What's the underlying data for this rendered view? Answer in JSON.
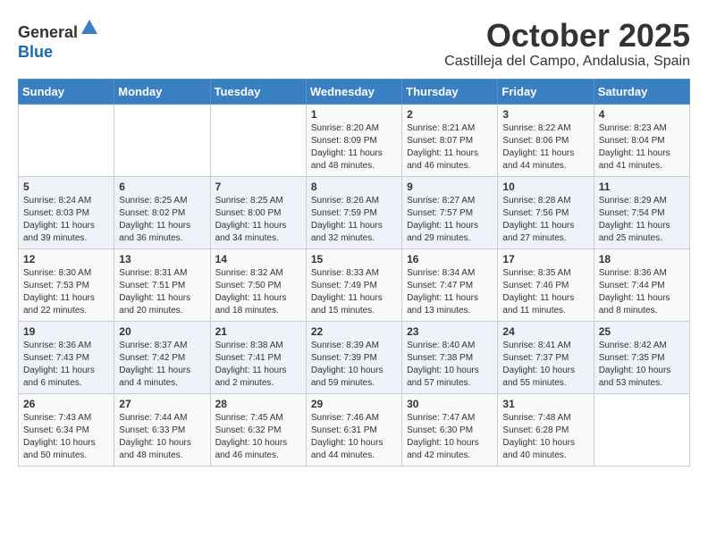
{
  "header": {
    "logo_line1": "General",
    "logo_line2": "Blue",
    "month": "October 2025",
    "location": "Castilleja del Campo, Andalusia, Spain"
  },
  "weekdays": [
    "Sunday",
    "Monday",
    "Tuesday",
    "Wednesday",
    "Thursday",
    "Friday",
    "Saturday"
  ],
  "weeks": [
    [
      {
        "day": "",
        "info": ""
      },
      {
        "day": "",
        "info": ""
      },
      {
        "day": "",
        "info": ""
      },
      {
        "day": "1",
        "info": "Sunrise: 8:20 AM\nSunset: 8:09 PM\nDaylight: 11 hours and 48 minutes."
      },
      {
        "day": "2",
        "info": "Sunrise: 8:21 AM\nSunset: 8:07 PM\nDaylight: 11 hours and 46 minutes."
      },
      {
        "day": "3",
        "info": "Sunrise: 8:22 AM\nSunset: 8:06 PM\nDaylight: 11 hours and 44 minutes."
      },
      {
        "day": "4",
        "info": "Sunrise: 8:23 AM\nSunset: 8:04 PM\nDaylight: 11 hours and 41 minutes."
      }
    ],
    [
      {
        "day": "5",
        "info": "Sunrise: 8:24 AM\nSunset: 8:03 PM\nDaylight: 11 hours and 39 minutes."
      },
      {
        "day": "6",
        "info": "Sunrise: 8:25 AM\nSunset: 8:02 PM\nDaylight: 11 hours and 36 minutes."
      },
      {
        "day": "7",
        "info": "Sunrise: 8:25 AM\nSunset: 8:00 PM\nDaylight: 11 hours and 34 minutes."
      },
      {
        "day": "8",
        "info": "Sunrise: 8:26 AM\nSunset: 7:59 PM\nDaylight: 11 hours and 32 minutes."
      },
      {
        "day": "9",
        "info": "Sunrise: 8:27 AM\nSunset: 7:57 PM\nDaylight: 11 hours and 29 minutes."
      },
      {
        "day": "10",
        "info": "Sunrise: 8:28 AM\nSunset: 7:56 PM\nDaylight: 11 hours and 27 minutes."
      },
      {
        "day": "11",
        "info": "Sunrise: 8:29 AM\nSunset: 7:54 PM\nDaylight: 11 hours and 25 minutes."
      }
    ],
    [
      {
        "day": "12",
        "info": "Sunrise: 8:30 AM\nSunset: 7:53 PM\nDaylight: 11 hours and 22 minutes."
      },
      {
        "day": "13",
        "info": "Sunrise: 8:31 AM\nSunset: 7:51 PM\nDaylight: 11 hours and 20 minutes."
      },
      {
        "day": "14",
        "info": "Sunrise: 8:32 AM\nSunset: 7:50 PM\nDaylight: 11 hours and 18 minutes."
      },
      {
        "day": "15",
        "info": "Sunrise: 8:33 AM\nSunset: 7:49 PM\nDaylight: 11 hours and 15 minutes."
      },
      {
        "day": "16",
        "info": "Sunrise: 8:34 AM\nSunset: 7:47 PM\nDaylight: 11 hours and 13 minutes."
      },
      {
        "day": "17",
        "info": "Sunrise: 8:35 AM\nSunset: 7:46 PM\nDaylight: 11 hours and 11 minutes."
      },
      {
        "day": "18",
        "info": "Sunrise: 8:36 AM\nSunset: 7:44 PM\nDaylight: 11 hours and 8 minutes."
      }
    ],
    [
      {
        "day": "19",
        "info": "Sunrise: 8:36 AM\nSunset: 7:43 PM\nDaylight: 11 hours and 6 minutes."
      },
      {
        "day": "20",
        "info": "Sunrise: 8:37 AM\nSunset: 7:42 PM\nDaylight: 11 hours and 4 minutes."
      },
      {
        "day": "21",
        "info": "Sunrise: 8:38 AM\nSunset: 7:41 PM\nDaylight: 11 hours and 2 minutes."
      },
      {
        "day": "22",
        "info": "Sunrise: 8:39 AM\nSunset: 7:39 PM\nDaylight: 10 hours and 59 minutes."
      },
      {
        "day": "23",
        "info": "Sunrise: 8:40 AM\nSunset: 7:38 PM\nDaylight: 10 hours and 57 minutes."
      },
      {
        "day": "24",
        "info": "Sunrise: 8:41 AM\nSunset: 7:37 PM\nDaylight: 10 hours and 55 minutes."
      },
      {
        "day": "25",
        "info": "Sunrise: 8:42 AM\nSunset: 7:35 PM\nDaylight: 10 hours and 53 minutes."
      }
    ],
    [
      {
        "day": "26",
        "info": "Sunrise: 7:43 AM\nSunset: 6:34 PM\nDaylight: 10 hours and 50 minutes."
      },
      {
        "day": "27",
        "info": "Sunrise: 7:44 AM\nSunset: 6:33 PM\nDaylight: 10 hours and 48 minutes."
      },
      {
        "day": "28",
        "info": "Sunrise: 7:45 AM\nSunset: 6:32 PM\nDaylight: 10 hours and 46 minutes."
      },
      {
        "day": "29",
        "info": "Sunrise: 7:46 AM\nSunset: 6:31 PM\nDaylight: 10 hours and 44 minutes."
      },
      {
        "day": "30",
        "info": "Sunrise: 7:47 AM\nSunset: 6:30 PM\nDaylight: 10 hours and 42 minutes."
      },
      {
        "day": "31",
        "info": "Sunrise: 7:48 AM\nSunset: 6:28 PM\nDaylight: 10 hours and 40 minutes."
      },
      {
        "day": "",
        "info": ""
      }
    ]
  ]
}
